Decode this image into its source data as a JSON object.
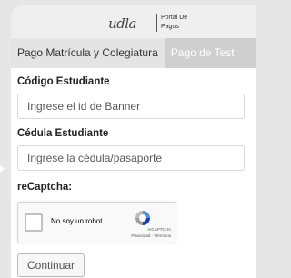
{
  "header": {
    "logo_text": "udla",
    "portal_line1": "Portal De",
    "portal_line2": "Pagos"
  },
  "tabs": [
    {
      "label": "Pago Matrícula y Colegiatura",
      "active": true
    },
    {
      "label": "Pago de Test",
      "active": false
    }
  ],
  "form": {
    "student_code_label": "Código Estudiante",
    "student_code_placeholder": "Ingrese el id de Banner",
    "id_label": "Cédula Estudiante",
    "id_placeholder": "Ingrese la cédula/pasaporte",
    "recaptcha_label": "reCaptcha:",
    "captcha": {
      "checkbox_text": "No soy un robot",
      "brand": "reCAPTCHA",
      "links": "Privacidad - Términos"
    },
    "submit_label": "Continuar"
  },
  "colors": {
    "page_background": "#e6e6e6",
    "tab_bar": "#cfcfcf",
    "active_tab": "#e4e4e4"
  }
}
